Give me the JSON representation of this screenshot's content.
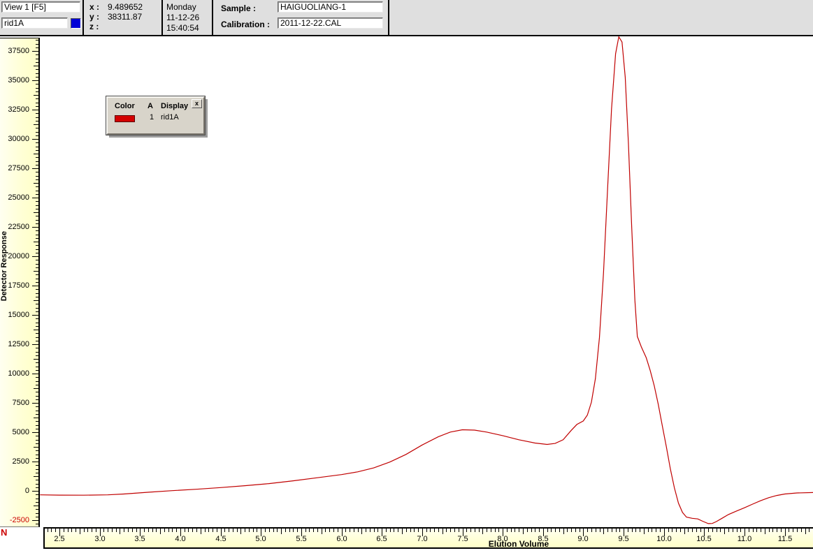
{
  "toolbar": {
    "view_field": "View 1 [F5]",
    "signal_field": "rid1A",
    "cursor": {
      "x_label": "x :",
      "x": "9.489652",
      "y_label": "y :",
      "y": "38311.87",
      "z_label": "z :",
      "z": ""
    },
    "datetime": {
      "day": "Monday",
      "date": "11-12-26",
      "time": "15:40:54"
    },
    "sample_label": "Sample :",
    "sample": "HAIGUOLIANG-1",
    "calibration_label": "Calibration :",
    "calibration": "2011-12-22.CAL"
  },
  "legend": {
    "headers": [
      "Color",
      "A",
      "Display"
    ],
    "row": {
      "channel": "1",
      "display": "rid1A",
      "color": "#D40000"
    },
    "close_label": "x"
  },
  "corner_mark": "N",
  "chart_data": {
    "type": "line",
    "title": "",
    "xlabel": "Elution Volume",
    "ylabel": "Detector Response",
    "xlim": [
      2.26,
      11.85
    ],
    "ylim": [
      -3000,
      38500
    ],
    "x_axis": {
      "major_step": 0.5,
      "minor_step": 0.05,
      "first_label": 2.5,
      "last_label": 11.5
    },
    "y_axis": {
      "major_step": 2500,
      "minor_step": 312.5,
      "first_label": -2500,
      "last_label": 37500
    },
    "negative_label_color": "#CC0000",
    "grid": false,
    "legend_position": "floating-window",
    "series": [
      {
        "name": "rid1A",
        "color": "#C00000",
        "points": [
          [
            2.26,
            -400
          ],
          [
            2.5,
            -420
          ],
          [
            2.8,
            -430
          ],
          [
            3.1,
            -400
          ],
          [
            3.3,
            -330
          ],
          [
            3.6,
            -180
          ],
          [
            3.9,
            -40
          ],
          [
            4.2,
            80
          ],
          [
            4.5,
            220
          ],
          [
            4.8,
            380
          ],
          [
            5.1,
            560
          ],
          [
            5.4,
            800
          ],
          [
            5.7,
            1060
          ],
          [
            6.0,
            1330
          ],
          [
            6.2,
            1560
          ],
          [
            6.4,
            1900
          ],
          [
            6.6,
            2400
          ],
          [
            6.8,
            3050
          ],
          [
            7.0,
            3850
          ],
          [
            7.2,
            4550
          ],
          [
            7.35,
            4950
          ],
          [
            7.5,
            5150
          ],
          [
            7.65,
            5120
          ],
          [
            7.8,
            4950
          ],
          [
            8.0,
            4650
          ],
          [
            8.2,
            4300
          ],
          [
            8.4,
            4020
          ],
          [
            8.55,
            3900
          ],
          [
            8.65,
            3980
          ],
          [
            8.75,
            4300
          ],
          [
            8.85,
            5100
          ],
          [
            8.92,
            5600
          ],
          [
            9.0,
            5900
          ],
          [
            9.05,
            6400
          ],
          [
            9.1,
            7500
          ],
          [
            9.15,
            9500
          ],
          [
            9.2,
            13000
          ],
          [
            9.25,
            18500
          ],
          [
            9.3,
            25500
          ],
          [
            9.35,
            32500
          ],
          [
            9.4,
            37200
          ],
          [
            9.44,
            38650
          ],
          [
            9.48,
            38200
          ],
          [
            9.52,
            35200
          ],
          [
            9.56,
            29500
          ],
          [
            9.6,
            22500
          ],
          [
            9.64,
            16200
          ],
          [
            9.67,
            13100
          ],
          [
            9.72,
            12200
          ],
          [
            9.78,
            11300
          ],
          [
            9.83,
            10200
          ],
          [
            9.88,
            8900
          ],
          [
            9.93,
            7300
          ],
          [
            9.98,
            5500
          ],
          [
            10.03,
            3700
          ],
          [
            10.08,
            1800
          ],
          [
            10.13,
            200
          ],
          [
            10.18,
            -1100
          ],
          [
            10.23,
            -1900
          ],
          [
            10.28,
            -2300
          ],
          [
            10.35,
            -2400
          ],
          [
            10.42,
            -2450
          ],
          [
            10.48,
            -2650
          ],
          [
            10.55,
            -2850
          ],
          [
            10.6,
            -2840
          ],
          [
            10.65,
            -2680
          ],
          [
            10.72,
            -2400
          ],
          [
            10.8,
            -2080
          ],
          [
            10.9,
            -1780
          ],
          [
            11.0,
            -1500
          ],
          [
            11.1,
            -1190
          ],
          [
            11.2,
            -900
          ],
          [
            11.3,
            -640
          ],
          [
            11.4,
            -450
          ],
          [
            11.5,
            -330
          ],
          [
            11.65,
            -240
          ],
          [
            11.85,
            -200
          ]
        ]
      }
    ]
  }
}
